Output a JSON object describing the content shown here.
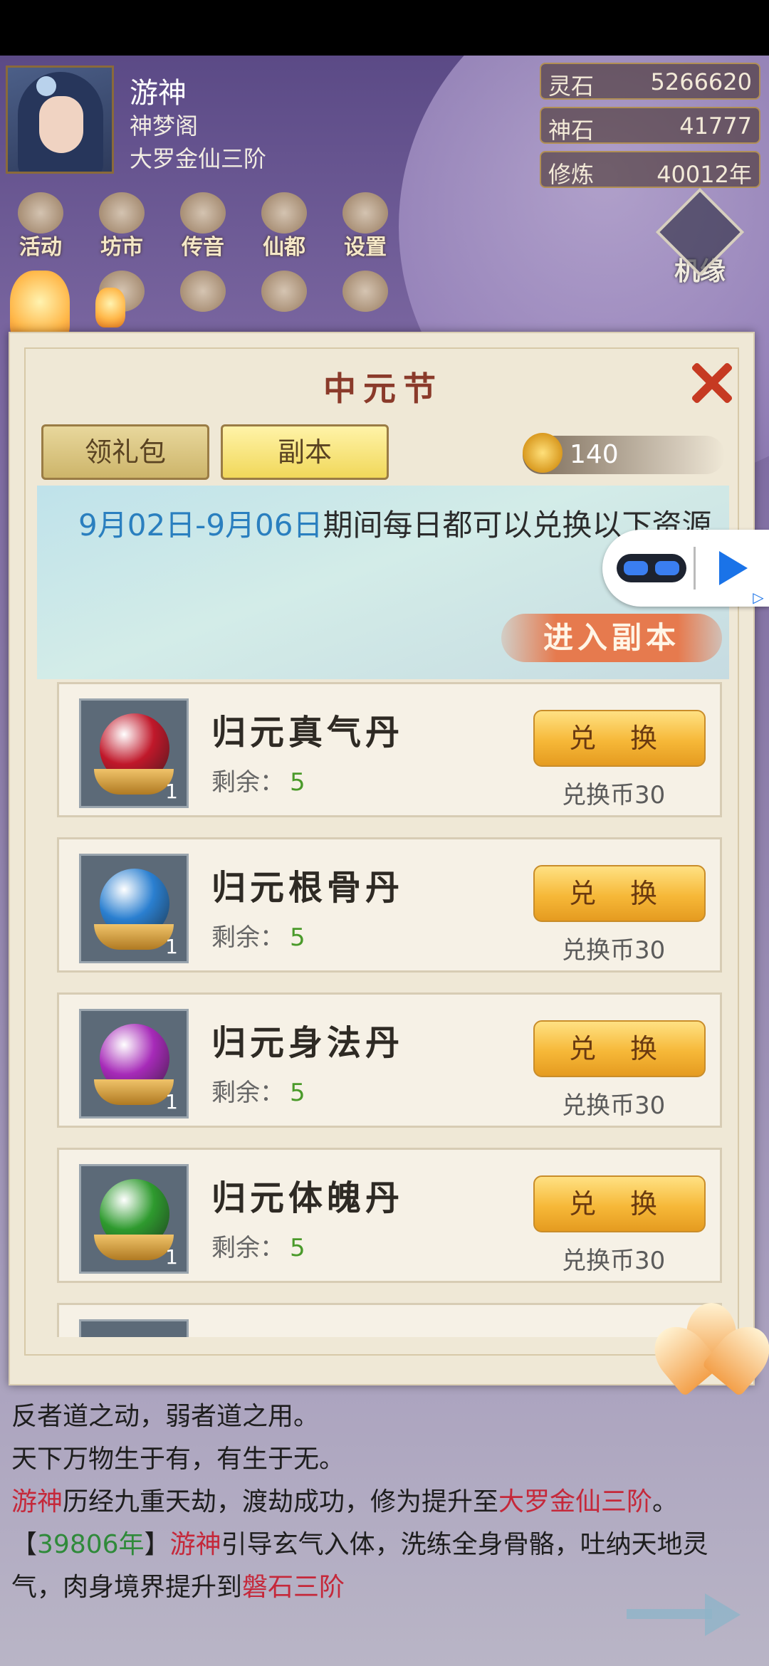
{
  "player": {
    "name": "游神",
    "sect": "神梦阁",
    "rank": "大罗金仙三阶"
  },
  "resources": [
    {
      "label": "灵石",
      "value": "5266620"
    },
    {
      "label": "神石",
      "value": "41777"
    },
    {
      "label": "修炼",
      "value": "40012年"
    }
  ],
  "menu": {
    "row1": [
      "活动",
      "坊市",
      "传音",
      "仙都",
      "设置"
    ],
    "side": "机缘"
  },
  "dialog": {
    "title": "中元节",
    "tabs": [
      "领礼包",
      "副本"
    ],
    "coins": "140",
    "banner_date": "9月02日-9月06日",
    "banner_text": "期间每日都可以兑换以下资源",
    "enter_button": "进入副本",
    "items": [
      {
        "name": "归元真气丹",
        "remain_label": "剩余：",
        "remain": "5",
        "qty": "1",
        "button": "兑 换",
        "cost": "兑换币30",
        "color": "#c0182a"
      },
      {
        "name": "归元根骨丹",
        "remain_label": "剩余：",
        "remain": "5",
        "qty": "1",
        "button": "兑 换",
        "cost": "兑换币30",
        "color": "#2a7fd0"
      },
      {
        "name": "归元身法丹",
        "remain_label": "剩余：",
        "remain": "5",
        "qty": "1",
        "button": "兑 换",
        "cost": "兑换币30",
        "color": "#a62ab8"
      },
      {
        "name": "归元体魄丹",
        "remain_label": "剩余：",
        "remain": "5",
        "qty": "1",
        "button": "兑 换",
        "cost": "兑换币30",
        "color": "#2e9a2e"
      }
    ]
  },
  "chat": {
    "line1": "反者道之动，弱者道之用。",
    "line2": "天下万物生于有，有生于无。",
    "line3_name": "游神",
    "line3_mid": "历经九重天劫，渡劫成功，修为提升至",
    "line3_rank": "大罗金仙三阶",
    "line3_end": "。",
    "line4_open": "【",
    "line4_year": "39806年",
    "line4_close": "】",
    "line4_name": "游神",
    "line4_text": "引导玄气入体，洗练全身骨骼，吐纳天地灵气，肉身境界提升到",
    "line4_realm": "磐石三阶"
  }
}
